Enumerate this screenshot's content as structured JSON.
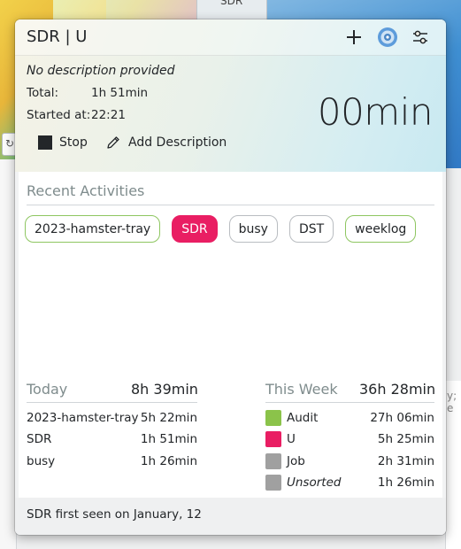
{
  "background": {
    "tab_label": "SDR",
    "right_text": "y; e"
  },
  "popup": {
    "title": "SDR | U",
    "icons": [
      "plus-icon",
      "hamster-app-icon",
      "settings-sliders-icon"
    ],
    "description": "No description provided",
    "total_label": "Total:",
    "total_value": "1h 51min",
    "started_label": "Started at:",
    "started_value": "22:21",
    "elapsed": "00min",
    "stop_label": "Stop",
    "add_description_label": "Add Description"
  },
  "recent": {
    "title": "Recent Activities",
    "chips": [
      {
        "label": "2023-hamster-tray",
        "style": "green"
      },
      {
        "label": "SDR",
        "style": "active"
      },
      {
        "label": "busy",
        "style": "gray"
      },
      {
        "label": "DST",
        "style": "gray"
      },
      {
        "label": "weeklog",
        "style": "green"
      }
    ]
  },
  "today": {
    "title": "Today",
    "total": "8h 39min",
    "rows": [
      {
        "name": "2023-hamster-tray",
        "value": "5h 22min"
      },
      {
        "name": "SDR",
        "value": "1h 51min"
      },
      {
        "name": "busy",
        "value": "1h 26min"
      }
    ]
  },
  "week": {
    "title": "This Week",
    "total": "36h 28min",
    "rows": [
      {
        "name": "Audit",
        "value": "27h 06min",
        "color": "#8bc34a"
      },
      {
        "name": "U",
        "value": "5h 25min",
        "color": "#e91e63"
      },
      {
        "name": "Job",
        "value": "2h 31min",
        "color": "#a0a0a0"
      },
      {
        "name": "Unsorted",
        "value": "1h 26min",
        "color": "#a0a0a0",
        "italic": true
      }
    ]
  },
  "footer": {
    "text": "SDR first seen on January, 12"
  },
  "colors": {
    "accent": "#e91e63",
    "chip_green_border": "#8ec661"
  }
}
